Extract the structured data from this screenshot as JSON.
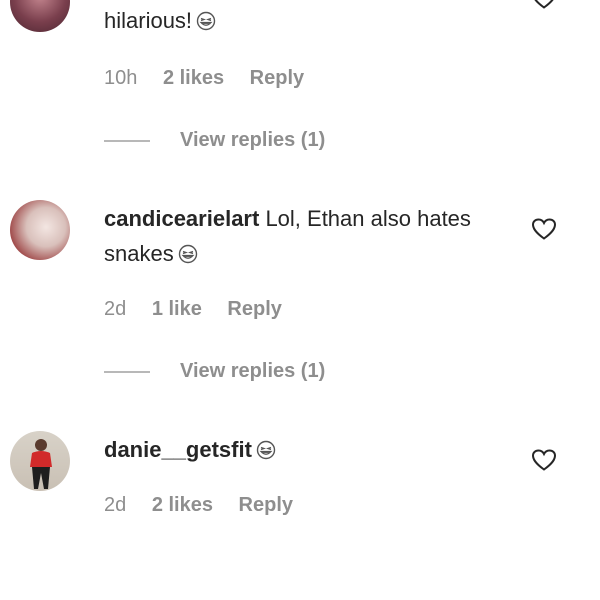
{
  "comments": [
    {
      "username": "",
      "text": "hilarious!",
      "emoji": "grinning-squinting-face-icon",
      "time": "10h",
      "likes": "2 likes",
      "reply": "Reply",
      "view_replies": "View replies (1)"
    },
    {
      "username": "candicearielart",
      "text": "Lol, Ethan also hates snakes",
      "emoji": "grinning-squinting-face-icon",
      "time": "2d",
      "likes": "1 like",
      "reply": "Reply",
      "view_replies": "View replies (1)"
    },
    {
      "username": "danie__getsfit",
      "text": "",
      "emoji": "grinning-squinting-face-icon",
      "time": "2d",
      "likes": "2 likes",
      "reply": "Reply"
    }
  ],
  "icons": {
    "like": "heart-outline-icon"
  },
  "colors": {
    "text": "#262626",
    "secondary": "#8e8e8e",
    "divider": "#b8b8b8"
  }
}
